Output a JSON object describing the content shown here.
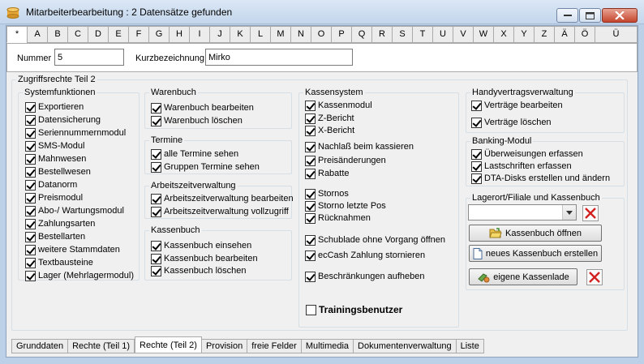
{
  "window": {
    "title": "Mitarbeiterbearbeitung : 2 Datensätze gefunden"
  },
  "letter_tabs": [
    "*",
    "A",
    "B",
    "C",
    "D",
    "E",
    "F",
    "G",
    "H",
    "I",
    "J",
    "K",
    "L",
    "M",
    "N",
    "O",
    "P",
    "Q",
    "R",
    "S",
    "T",
    "U",
    "V",
    "W",
    "X",
    "Y",
    "Z",
    "Ä",
    "Ö",
    "Ü"
  ],
  "fields": {
    "nummer_label": "Nummer",
    "nummer_value": "5",
    "kurz_label": "Kurzbezeichnung",
    "kurz_value": "Mirko"
  },
  "main_group": "Zugriffsrechte Teil 2",
  "system": {
    "title": "Systemfunktionen",
    "items": [
      {
        "label": "Exportieren",
        "checked": true
      },
      {
        "label": "Datensicherung",
        "checked": true
      },
      {
        "label": "Seriennummernmodul",
        "checked": true
      },
      {
        "label": "SMS-Modul",
        "checked": true
      },
      {
        "label": "Mahnwesen",
        "checked": true
      },
      {
        "label": "Bestellwesen",
        "checked": true
      },
      {
        "label": "Datanorm",
        "checked": true
      },
      {
        "label": "Preismodul",
        "checked": true
      },
      {
        "label": "Abo-/ Wartungsmodul",
        "checked": true
      },
      {
        "label": "Zahlungsarten",
        "checked": true
      },
      {
        "label": "Bestellarten",
        "checked": true
      },
      {
        "label": "weitere Stammdaten",
        "checked": true
      },
      {
        "label": "Textbausteine",
        "checked": true
      },
      {
        "label": "Lager (Mehrlagermodul)",
        "checked": true
      }
    ]
  },
  "warenbuch": {
    "title": "Warenbuch",
    "items": [
      {
        "label": "Warenbuch bearbeiten",
        "checked": true
      },
      {
        "label": "Warenbuch löschen",
        "checked": true
      }
    ]
  },
  "termine": {
    "title": "Termine",
    "items": [
      {
        "label": "alle Termine sehen",
        "checked": true
      },
      {
        "label": "Gruppen Termine sehen",
        "checked": true
      }
    ]
  },
  "arbeitszeit": {
    "title": "Arbeitszeitverwaltung",
    "items": [
      {
        "label": "Arbeitszeitverwaltung bearbeiten",
        "checked": true
      },
      {
        "label": "Arbeitszeitverwaltung vollzugriff",
        "checked": true
      }
    ]
  },
  "kassenbuch": {
    "title": "Kassenbuch",
    "items": [
      {
        "label": "Kassenbuch einsehen",
        "checked": true
      },
      {
        "label": "Kassenbuch bearbeiten",
        "checked": true
      },
      {
        "label": "Kassenbuch löschen",
        "checked": true
      }
    ]
  },
  "kassensystem": {
    "title": "Kassensystem",
    "items": [
      {
        "label": "Kassenmodul",
        "checked": true
      },
      {
        "label": "Z-Bericht",
        "checked": true
      },
      {
        "label": "X-Bericht",
        "checked": true
      },
      {
        "label": "Nachlaß beim kassieren",
        "checked": true
      },
      {
        "label": "Preisänderungen",
        "checked": true
      },
      {
        "label": "Rabatte",
        "checked": true
      },
      {
        "label": "Stornos",
        "checked": true
      },
      {
        "label": "Storno letzte Pos",
        "checked": true
      },
      {
        "label": "Rücknahmen",
        "checked": true
      },
      {
        "label": "Schublade ohne Vorgang öffnen",
        "checked": true
      },
      {
        "label": "ecCash Zahlung stornieren",
        "checked": true
      },
      {
        "label": "Beschränkungen aufheben",
        "checked": true
      }
    ],
    "training": {
      "label": "Trainingsbenutzer",
      "checked": false
    }
  },
  "handy": {
    "title": "Handyvertragsverwaltung",
    "items": [
      {
        "label": "Verträge bearbeiten",
        "checked": true
      },
      {
        "label": "Verträge löschen",
        "checked": true
      }
    ]
  },
  "banking": {
    "title": "Banking-Modul",
    "items": [
      {
        "label": "Überweisungen erfassen",
        "checked": true
      },
      {
        "label": "Lastschriften erfassen",
        "checked": true
      },
      {
        "label": "DTA-Disks erstellen und ändern",
        "checked": true
      }
    ]
  },
  "lager": {
    "title": "Lagerort/Filiale und Kassenbuch",
    "select_value": "",
    "btn_open": "Kassenbuch öffnen",
    "btn_new": "neues Kassenbuch erstellen",
    "btn_lade": "eigene Kassenlade"
  },
  "bottom_tabs": [
    "Grunddaten",
    "Rechte (Teil 1)",
    "Rechte (Teil 2)",
    "Provision",
    "freie Felder",
    "Multimedia",
    "Dokumentenverwaltung",
    "Liste"
  ],
  "active_bottom_tab": 2,
  "active_letter_tab": 0
}
